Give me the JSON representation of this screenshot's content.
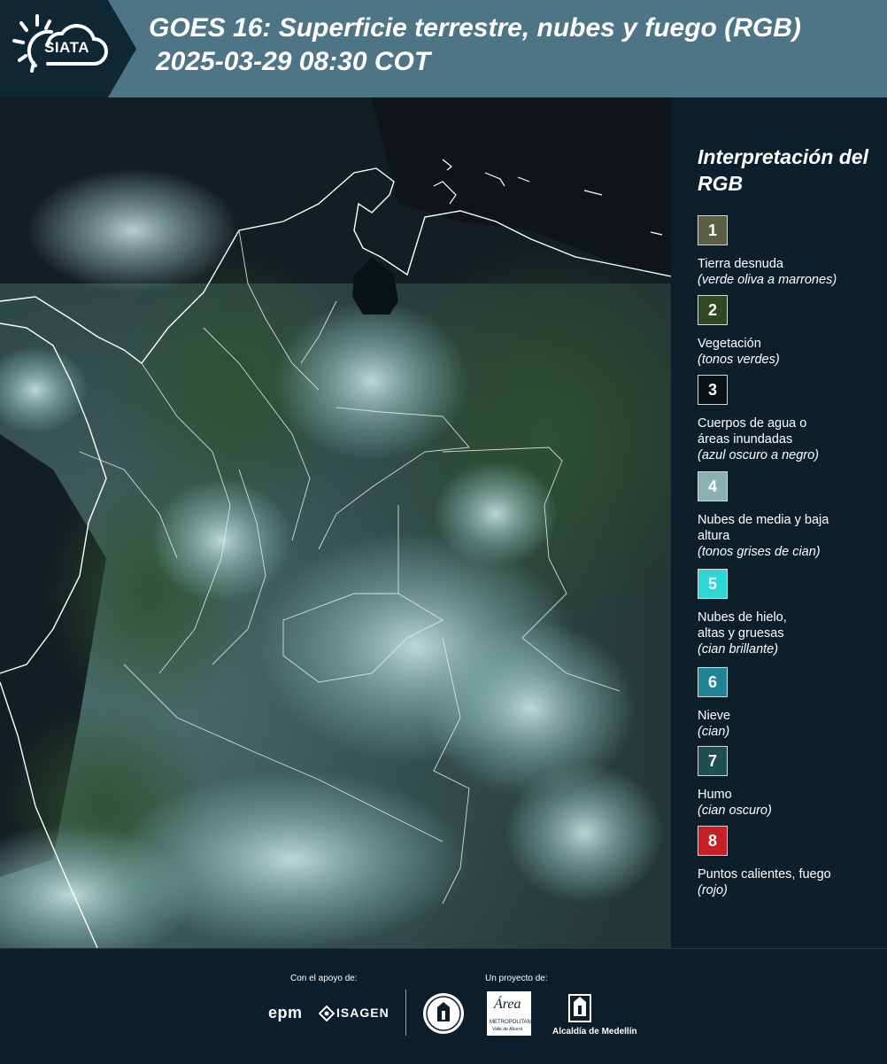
{
  "header": {
    "logo_text": "SIATA",
    "title": "GOES 16: Superficie terrestre, nubes y fuego (RGB)",
    "subtitle": "2025-03-29 08:30 COT"
  },
  "map": {
    "icon": "satellite-rgb-map",
    "colors": {
      "land": "#2c4a2e",
      "cloud_low": "#7fa8a6",
      "cloud_high": "#bfe3e0",
      "water": "#0b1216",
      "border": "#ffffff"
    }
  },
  "legend": {
    "title": "Interpretación del RGB",
    "items": [
      {
        "num": "1",
        "color": "#5d5f44",
        "label": "Tierra desnuda",
        "sub": "(verde oliva a marrones)"
      },
      {
        "num": "2",
        "color": "#2f4a22",
        "label": "Vegetación",
        "sub": "(tonos verdes)"
      },
      {
        "num": "3",
        "color": "#0b1216",
        "label": "Cuerpos de agua o áreas inundadas",
        "sub": "(azul oscuro a negro)"
      },
      {
        "num": "4",
        "color": "#8ab0b0",
        "label": "Nubes de media y baja altura",
        "sub": "(tonos grises de cian)"
      },
      {
        "num": "5",
        "color": "#2ed7d3",
        "label": "Nubes de hielo, altas y gruesas",
        "sub": "(cian brillante)"
      },
      {
        "num": "6",
        "color": "#1f8596",
        "label": "Nieve",
        "sub": "(cian)"
      },
      {
        "num": "7",
        "color": "#1e5052",
        "label": "Humo",
        "sub": "(cian oscuro)"
      },
      {
        "num": "8",
        "color": "#c62026",
        "label": "Puntos calientes, fuego",
        "sub": "(rojo)"
      }
    ]
  },
  "footer": {
    "support_label": "Con el apoyo de:",
    "project_label": "Un proyecto de:",
    "epm": "epm",
    "isagen": "ISAGEN",
    "amva_text": "Área",
    "amva_sub1": "METROPOLITANA",
    "amva_sub2": "Valle de Aburrá",
    "medellin_label": "Alcaldía de Medellín"
  }
}
